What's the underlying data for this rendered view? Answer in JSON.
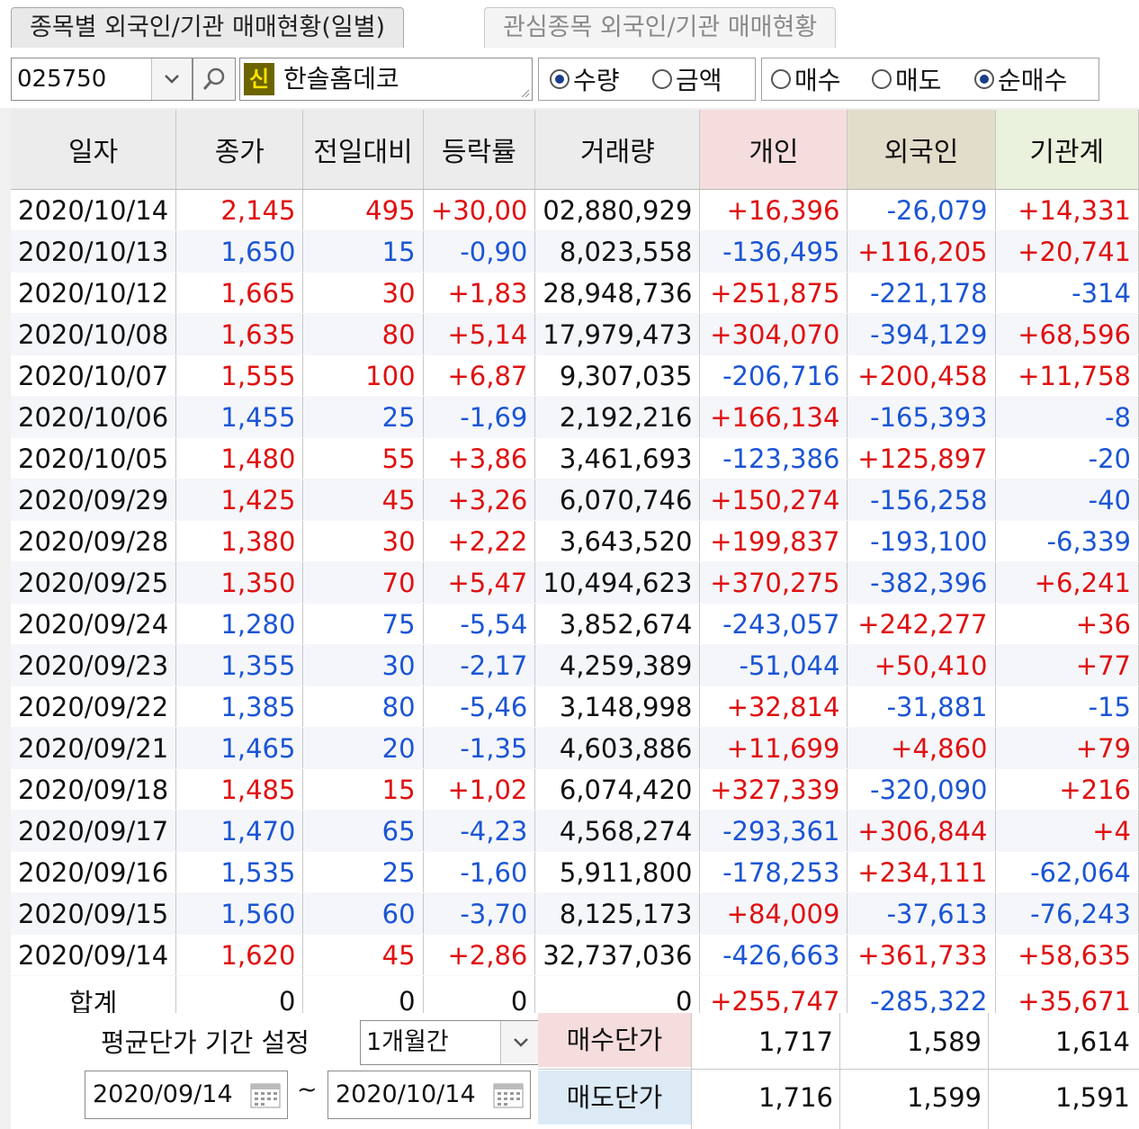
{
  "tabs": [
    {
      "label": "종목별 외국인/기관 매매현황(일별)"
    },
    {
      "label": "관심종목 외국인/기관 매매현황"
    }
  ],
  "toolbar": {
    "code": "025750",
    "badge": "신",
    "stock_name": "한솔홈데코",
    "unit_options": [
      {
        "label": "수량",
        "selected": true
      },
      {
        "label": "금액",
        "selected": false
      }
    ],
    "type_options": [
      {
        "label": "매수",
        "selected": false
      },
      {
        "label": "매도",
        "selected": false
      },
      {
        "label": "순매수",
        "selected": true
      }
    ]
  },
  "table": {
    "headers": [
      "일자",
      "종가",
      "전일대비",
      "등락률",
      "거래량",
      "개인",
      "외국인",
      "기관계"
    ],
    "rows": [
      {
        "date": "2020/10/14",
        "close": "2,145",
        "change": "495",
        "rate": "+30,00",
        "volume": "02,880,929",
        "indiv": "+16,396",
        "foreign": "-26,079",
        "inst": "+14,331",
        "dir": "up"
      },
      {
        "date": "2020/10/13",
        "close": "1,650",
        "change": "15",
        "rate": "-0,90",
        "volume": "8,023,558",
        "indiv": "-136,495",
        "foreign": "+116,205",
        "inst": "+20,741",
        "dir": "down"
      },
      {
        "date": "2020/10/12",
        "close": "1,665",
        "change": "30",
        "rate": "+1,83",
        "volume": "28,948,736",
        "indiv": "+251,875",
        "foreign": "-221,178",
        "inst": "-314",
        "dir": "up"
      },
      {
        "date": "2020/10/08",
        "close": "1,635",
        "change": "80",
        "rate": "+5,14",
        "volume": "17,979,473",
        "indiv": "+304,070",
        "foreign": "-394,129",
        "inst": "+68,596",
        "dir": "up"
      },
      {
        "date": "2020/10/07",
        "close": "1,555",
        "change": "100",
        "rate": "+6,87",
        "volume": "9,307,035",
        "indiv": "-206,716",
        "foreign": "+200,458",
        "inst": "+11,758",
        "dir": "up"
      },
      {
        "date": "2020/10/06",
        "close": "1,455",
        "change": "25",
        "rate": "-1,69",
        "volume": "2,192,216",
        "indiv": "+166,134",
        "foreign": "-165,393",
        "inst": "-8",
        "dir": "down"
      },
      {
        "date": "2020/10/05",
        "close": "1,480",
        "change": "55",
        "rate": "+3,86",
        "volume": "3,461,693",
        "indiv": "-123,386",
        "foreign": "+125,897",
        "inst": "-20",
        "dir": "up"
      },
      {
        "date": "2020/09/29",
        "close": "1,425",
        "change": "45",
        "rate": "+3,26",
        "volume": "6,070,746",
        "indiv": "+150,274",
        "foreign": "-156,258",
        "inst": "-40",
        "dir": "up"
      },
      {
        "date": "2020/09/28",
        "close": "1,380",
        "change": "30",
        "rate": "+2,22",
        "volume": "3,643,520",
        "indiv": "+199,837",
        "foreign": "-193,100",
        "inst": "-6,339",
        "dir": "up"
      },
      {
        "date": "2020/09/25",
        "close": "1,350",
        "change": "70",
        "rate": "+5,47",
        "volume": "10,494,623",
        "indiv": "+370,275",
        "foreign": "-382,396",
        "inst": "+6,241",
        "dir": "up"
      },
      {
        "date": "2020/09/24",
        "close": "1,280",
        "change": "75",
        "rate": "-5,54",
        "volume": "3,852,674",
        "indiv": "-243,057",
        "foreign": "+242,277",
        "inst": "+36",
        "dir": "down"
      },
      {
        "date": "2020/09/23",
        "close": "1,355",
        "change": "30",
        "rate": "-2,17",
        "volume": "4,259,389",
        "indiv": "-51,044",
        "foreign": "+50,410",
        "inst": "+77",
        "dir": "down"
      },
      {
        "date": "2020/09/22",
        "close": "1,385",
        "change": "80",
        "rate": "-5,46",
        "volume": "3,148,998",
        "indiv": "+32,814",
        "foreign": "-31,881",
        "inst": "-15",
        "dir": "down"
      },
      {
        "date": "2020/09/21",
        "close": "1,465",
        "change": "20",
        "rate": "-1,35",
        "volume": "4,603,886",
        "indiv": "+11,699",
        "foreign": "+4,860",
        "inst": "+79",
        "dir": "down"
      },
      {
        "date": "2020/09/18",
        "close": "1,485",
        "change": "15",
        "rate": "+1,02",
        "volume": "6,074,420",
        "indiv": "+327,339",
        "foreign": "-320,090",
        "inst": "+216",
        "dir": "up"
      },
      {
        "date": "2020/09/17",
        "close": "1,470",
        "change": "65",
        "rate": "-4,23",
        "volume": "4,568,274",
        "indiv": "-293,361",
        "foreign": "+306,844",
        "inst": "+4",
        "dir": "down"
      },
      {
        "date": "2020/09/16",
        "close": "1,535",
        "change": "25",
        "rate": "-1,60",
        "volume": "5,911,800",
        "indiv": "-178,253",
        "foreign": "+234,111",
        "inst": "-62,064",
        "dir": "down"
      },
      {
        "date": "2020/09/15",
        "close": "1,560",
        "change": "60",
        "rate": "-3,70",
        "volume": "8,125,173",
        "indiv": "+84,009",
        "foreign": "-37,613",
        "inst": "-76,243",
        "dir": "down"
      },
      {
        "date": "2020/09/14",
        "close": "1,620",
        "change": "45",
        "rate": "+2,86",
        "volume": "32,737,036",
        "indiv": "-426,663",
        "foreign": "+361,733",
        "inst": "+58,635",
        "dir": "up"
      }
    ],
    "summary": {
      "label": "합계",
      "close": "0",
      "change": "0",
      "rate": "0",
      "volume": "0",
      "indiv": "+255,747",
      "foreign": "-285,322",
      "inst": "+35,671"
    }
  },
  "avg_price": {
    "label": "평균단가 기간 설정",
    "period": "1개월간",
    "start_date": "2020/09/14",
    "separator": "~",
    "end_date": "2020/10/14",
    "buy_label": "매수단가",
    "sell_label": "매도단가",
    "buy_values": [
      "1,717",
      "1,589",
      "1,614"
    ],
    "sell_values": [
      "1,716",
      "1,599",
      "1,591"
    ]
  },
  "colors": {
    "up": "#e01010",
    "down": "#1b55d4",
    "neutral": "#111111",
    "accent_badge": "#6b6400"
  },
  "icons": [
    "chevron-down-icon",
    "search-icon",
    "calendar-icon",
    "resize-grip-icon"
  ]
}
